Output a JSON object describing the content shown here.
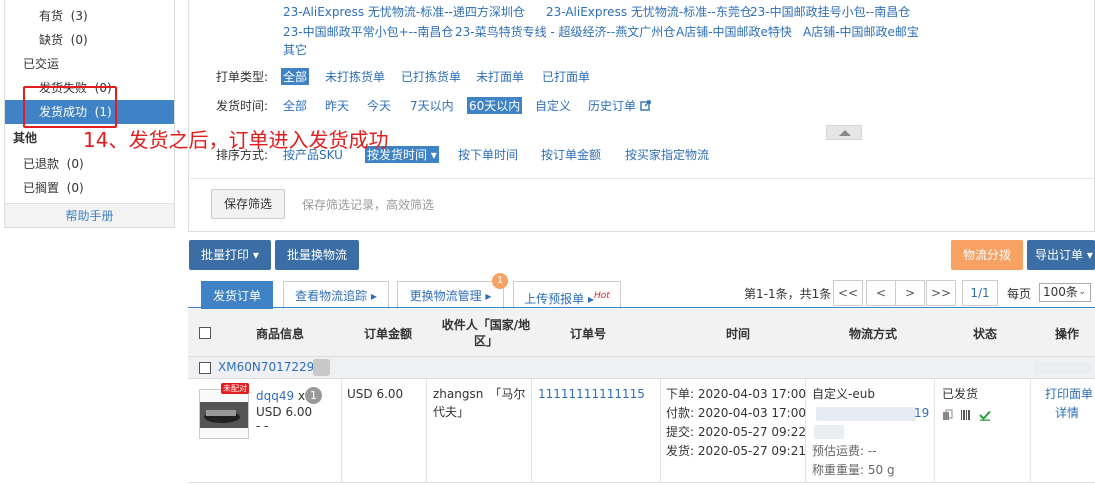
{
  "sidebar": {
    "items": [
      {
        "label": "有货",
        "count": "(3)"
      },
      {
        "label": "缺货",
        "count": "(0)"
      },
      {
        "label": "已交运"
      },
      {
        "label": "发货失败",
        "count": "(0)"
      },
      {
        "label": "发货成功",
        "count": "(1)"
      },
      {
        "label": "其他"
      },
      {
        "label": "已退款",
        "count": "(0)"
      },
      {
        "label": "已搁置",
        "count": "(0)"
      }
    ],
    "help": "帮助手册"
  },
  "annotation": "14、发货之后，订单进入发货成功",
  "filters": {
    "logistics_options": [
      "23-AliExpress 无忧物流-标准--递四方深圳仓",
      "23-AliExpress 无忧物流-标准--东莞仓",
      "23-中国邮政挂号小包--南昌仓",
      "23-中国邮政平常小包+--南昌仓",
      "23-菜鸟特货专线 - 超级经济--燕文广州仓",
      "A店铺-中国邮政e特快",
      "A店铺-中国邮政e邮宝",
      "其它"
    ],
    "print_type_label": "打单类型:",
    "print_type_options": [
      "全部",
      "未打拣货单",
      "已打拣货单",
      "未打面单",
      "已打面单"
    ],
    "ship_time_label": "发货时间:",
    "ship_time_options": [
      "全部",
      "昨天",
      "今天",
      "7天以内",
      "60天以内",
      "自定义",
      "历史订单"
    ],
    "sort_label": "排序方式:",
    "sort_options": [
      "按产品SKU",
      "按发货时间 ▾",
      "按下单时间",
      "按订单金额",
      "按买家指定物流"
    ],
    "save_button": "保存筛选",
    "save_hint": "保存筛选记录，高效筛选"
  },
  "toolbar": {
    "batch_print": "批量打印 ▾",
    "batch_change": "批量换物流",
    "logistics_split": "物流分拨",
    "export": "导出订单 ▾"
  },
  "tabs": [
    "发货订单",
    "查看物流追踪 ▸",
    "更换物流管理 ▸",
    "上传预报单 ▸"
  ],
  "tab_badge": "1",
  "hot_label": "Hot",
  "pager": {
    "summary": "第1-1条，共1条",
    "buttons": [
      "<<",
      "<",
      ">",
      ">>"
    ],
    "page": "1/1",
    "per_page_label": "每页",
    "per_page_value": "100条"
  },
  "table": {
    "headers": [
      "商品信息",
      "订单金额",
      "收件人「国家/地区」",
      "订单号",
      "时间",
      "物流方式",
      "状态",
      "操作"
    ],
    "group_id": "XM60N7017229",
    "row": {
      "badge": "未配对",
      "product": "dqq49",
      "qty_prefix": "x",
      "qty": "1",
      "product_price": "USD 6.00",
      "dash": "- -",
      "amount": "USD 6.00",
      "recipient_line1": "zhangsn　「马尔",
      "recipient_line2": "代夫」",
      "order_no": "11111111111115",
      "times": [
        "下单: 2020-04-03 17:00",
        "付款: 2020-04-03 17:00",
        "提交: 2020-05-27 09:22",
        "发货: 2020-05-27 09:21"
      ],
      "logistics": "自定义-eub",
      "tracking_tail": "19",
      "est_fee": "预估运费: --",
      "weight": "称重重量: 50 g",
      "status": "已发货",
      "actions": [
        "打印面单",
        "详情"
      ]
    }
  },
  "colors": {
    "accent": "#3f83c6",
    "link": "#2f6fb8",
    "annotation": "#e21d1d",
    "orange": "#f7a162",
    "check": "#2a9d3a"
  }
}
